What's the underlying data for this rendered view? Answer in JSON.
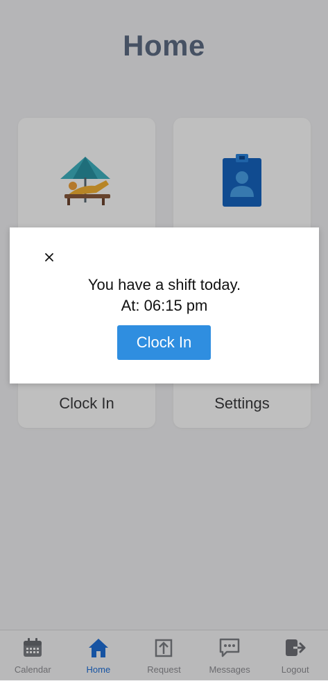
{
  "header": {
    "title": "Home"
  },
  "tiles": [
    {
      "label": "Clock In",
      "icon": "beach-lounger-icon"
    },
    {
      "label": "Settings",
      "icon": "id-badge-icon"
    }
  ],
  "modal": {
    "message_line1": "You have a shift today.",
    "message_line2": "At: 06:15 pm",
    "button_label": "Clock In",
    "close_icon": "close-icon"
  },
  "tabbar": {
    "items": [
      {
        "label": "Calendar",
        "icon": "calendar-icon",
        "active": false
      },
      {
        "label": "Home",
        "icon": "home-icon",
        "active": true
      },
      {
        "label": "Request",
        "icon": "upload-icon",
        "active": false
      },
      {
        "label": "Messages",
        "icon": "chat-bubble-icon",
        "active": false
      },
      {
        "label": "Logout",
        "icon": "logout-icon",
        "active": false
      }
    ]
  },
  "colors": {
    "accent": "#2f8ee0",
    "active_tab": "#1e6fd9",
    "header_text": "#5e6d84"
  }
}
